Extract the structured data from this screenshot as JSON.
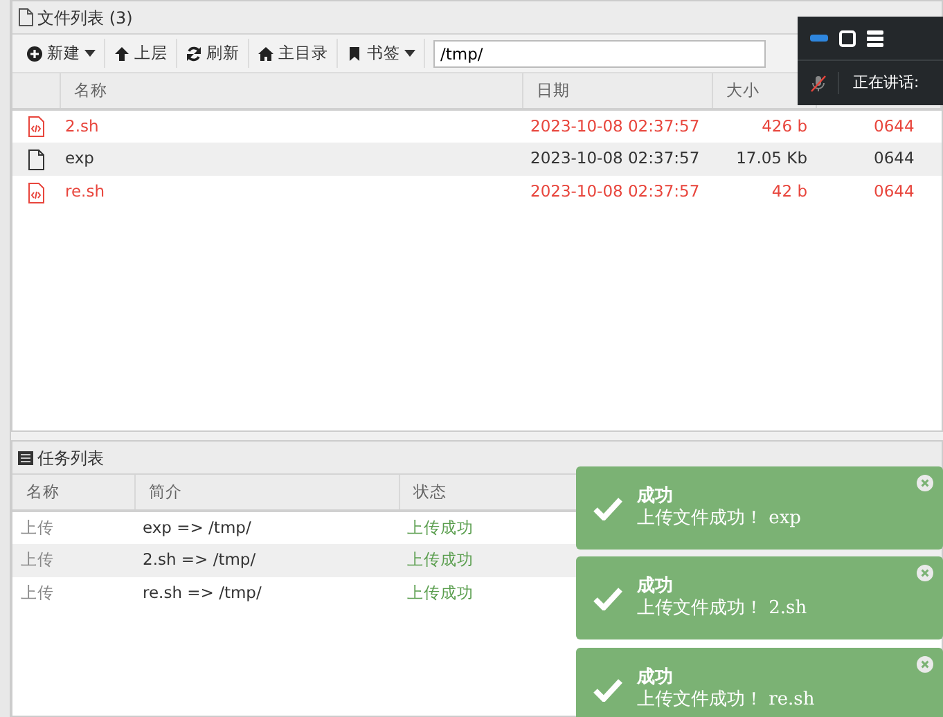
{
  "file_panel": {
    "title": "文件列表 (3)",
    "toolbar": [
      {
        "kind": "new",
        "label": "新建",
        "dropdown": true
      },
      {
        "kind": "up",
        "label": "上层",
        "dropdown": false
      },
      {
        "kind": "refresh",
        "label": "刷新",
        "dropdown": false
      },
      {
        "kind": "home",
        "label": "主目录",
        "dropdown": false
      },
      {
        "kind": "bookmark",
        "label": "书签",
        "dropdown": true
      }
    ],
    "path": "/tmp/",
    "columns": [
      "名称",
      "日期",
      "大小"
    ],
    "rows": [
      {
        "kind": "script",
        "name": "2.sh",
        "date": "2023-10-08 02:37:57",
        "size": "426 b",
        "perm": "0644"
      },
      {
        "kind": "file",
        "name": "exp",
        "date": "2023-10-08 02:37:57",
        "size": "17.05 Kb",
        "perm": "0644"
      },
      {
        "kind": "script",
        "name": "re.sh",
        "date": "2023-10-08 02:37:57",
        "size": "42 b",
        "perm": "0644"
      }
    ]
  },
  "voice_widget": {
    "mic_muted": true,
    "status": "正在讲话:"
  },
  "task_panel": {
    "title": "任务列表",
    "columns": [
      "名称",
      "简介",
      "状态"
    ],
    "rows": [
      {
        "name": "上传",
        "summary": "exp => /tmp/",
        "status": "上传成功"
      },
      {
        "name": "上传",
        "summary": "2.sh => /tmp/",
        "status": "上传成功"
      },
      {
        "name": "上传",
        "summary": "re.sh => /tmp/",
        "status": "上传成功"
      }
    ]
  },
  "toasts": [
    {
      "title": "成功",
      "message": "上传文件成功！ exp"
    },
    {
      "title": "成功",
      "message": "上传文件成功！ 2.sh"
    },
    {
      "title": "成功",
      "message": "上传文件成功！ re.sh"
    }
  ]
}
